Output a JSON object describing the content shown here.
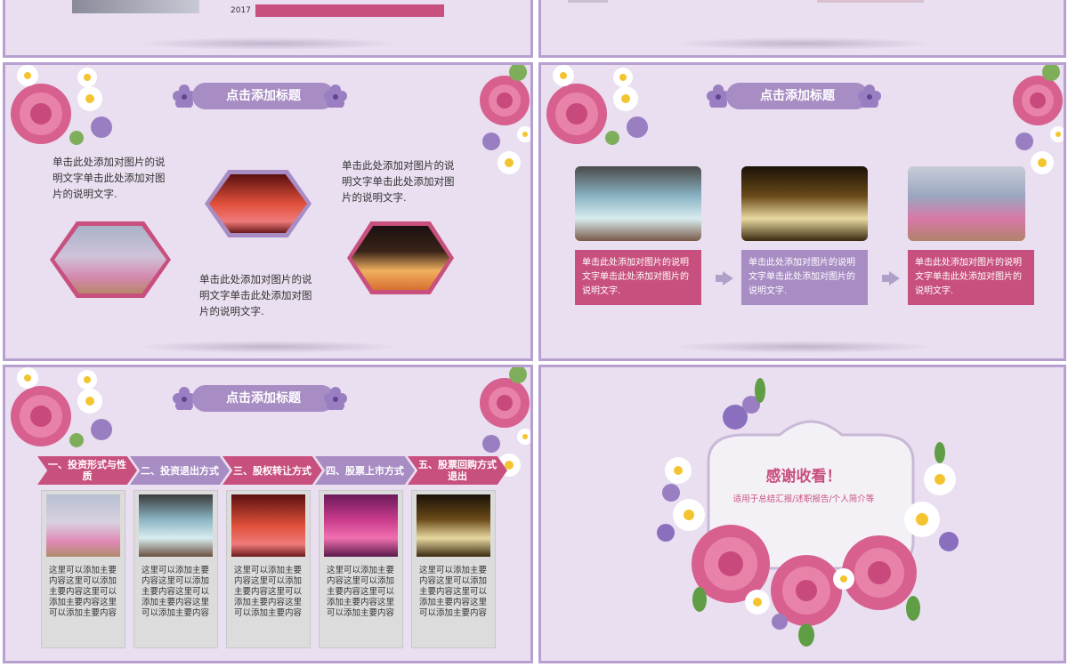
{
  "colors": {
    "accent_pink": "#c8507e",
    "accent_lilac": "#a88cc4",
    "slide_bg": "#e9dff0",
    "border": "#b79fcf"
  },
  "slide_top_left": {
    "year": "2017"
  },
  "slide2": {
    "title": "点击添加标题",
    "caption_1": "单击此处添加对图片的说明文字单击此处添加对图片的说明文字.",
    "caption_2": "单击此处添加对图片的说明文字单击此处添加对图片的说明文字.",
    "caption_3": "单击此处添加对图片的说明文字单击此处添加对图片的说明文字."
  },
  "slide3": {
    "title": "点击添加标题",
    "boxes": [
      "单击此处添加对图片的说明文字单击此处添加对图片的说明文字.",
      "单击此处添加对图片的说明文字单击此处添加对图片的说明文字.",
      "单击此处添加对图片的说明文字单击此处添加对图片的说明文字."
    ]
  },
  "slide4": {
    "title": "点击添加标题",
    "steps": [
      "一、投资形式与性质",
      "二、投资退出方式",
      "三、股权转让方式",
      "四、股票上市方式",
      "五、股票回购方式退出"
    ],
    "cards": [
      "这里可以添加主要内容这里可以添加主要内容这里可以添加主要内容这里可以添加主要内容",
      "这里可以添加主要内容这里可以添加主要内容这里可以添加主要内容这里可以添加主要内容",
      "这里可以添加主要内容这里可以添加主要内容这里可以添加主要内容这里可以添加主要内容",
      "这里可以添加主要内容这里可以添加主要内容这里可以添加主要内容这里可以添加主要内容",
      "这里可以添加主要内容这里可以添加主要内容这里可以添加主要内容这里可以添加主要内容"
    ]
  },
  "slide5": {
    "thanks": "感谢收看！",
    "subtitle": "适用于总结汇报/述职报告/个人简介等"
  }
}
